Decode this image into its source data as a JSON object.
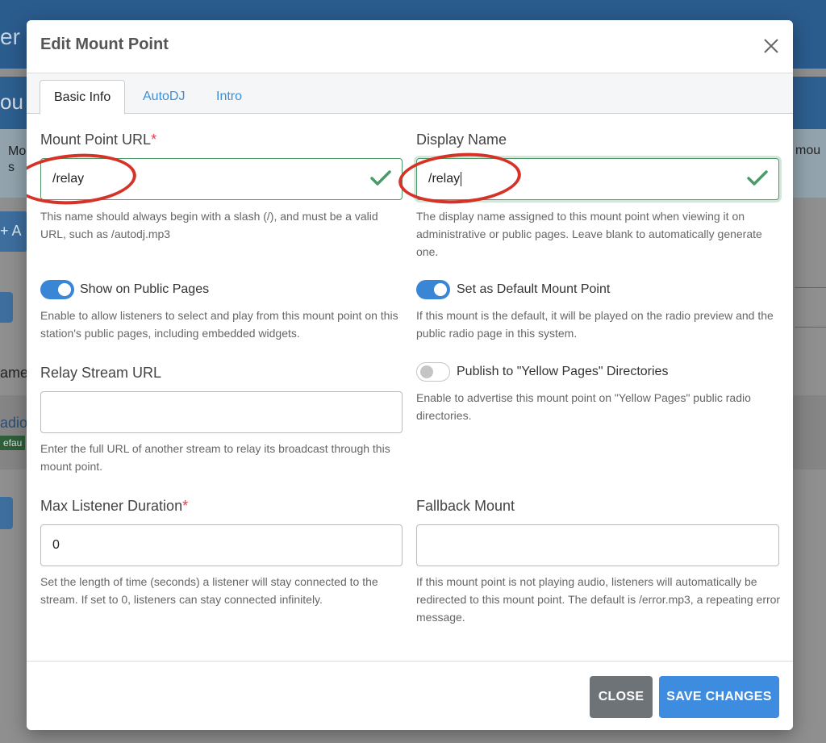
{
  "background": {
    "topbar_fragment": "er",
    "header_fragment": "ou",
    "info_left_line1": "Mo",
    "info_left_line2": "s",
    "info_right": "mou",
    "add_fragment": "+ A",
    "name_fragment": "ame",
    "row_link_fragment": "adio",
    "row_badge_fragment": "efau"
  },
  "modal": {
    "title": "Edit Mount Point",
    "close_icon": "close-icon",
    "tabs": [
      {
        "label": "Basic Info",
        "active": true
      },
      {
        "label": "AutoDJ",
        "active": false
      },
      {
        "label": "Intro",
        "active": false
      }
    ]
  },
  "form": {
    "mount_url": {
      "label": "Mount Point URL",
      "required_mark": "*",
      "value": "/relay",
      "help": "This name should always begin with a slash (/), and must be a valid URL, such as /autodj.mp3"
    },
    "display_name": {
      "label": "Display Name",
      "value": "/relay",
      "help": "The display name assigned to this mount point when viewing it on administrative or public pages. Leave blank to automatically generate one."
    },
    "show_public": {
      "label": "Show on Public Pages",
      "enabled": true,
      "help": "Enable to allow listeners to select and play from this mount point on this station's public pages, including embedded widgets."
    },
    "default_mount": {
      "label": "Set as Default Mount Point",
      "enabled": true,
      "help": "If this mount is the default, it will be played on the radio preview and the public radio page in this system."
    },
    "relay_url": {
      "label": "Relay Stream URL",
      "value": "",
      "help": "Enter the full URL of another stream to relay its broadcast through this mount point."
    },
    "yellow_pages": {
      "label": "Publish to \"Yellow Pages\" Directories",
      "enabled": false,
      "help": "Enable to advertise this mount point on \"Yellow Pages\" public radio directories."
    },
    "max_duration": {
      "label": "Max Listener Duration",
      "required_mark": "*",
      "value": "0",
      "help": "Set the length of time (seconds) a listener will stay connected to the stream. If set to 0, listeners can stay connected infinitely."
    },
    "fallback_mount": {
      "label": "Fallback Mount",
      "value": "",
      "help": "If this mount point is not playing audio, listeners will automatically be redirected to this mount point. The default is /error.mp3, a repeating error message."
    }
  },
  "footer": {
    "close_label": "CLOSE",
    "save_label": "SAVE CHANGES"
  },
  "colors": {
    "accent": "#3e8ce0",
    "valid": "#4a9b67",
    "required": "#e0404c",
    "annotation": "#d63228"
  }
}
